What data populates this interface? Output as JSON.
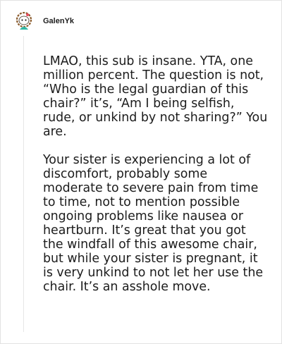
{
  "comment": {
    "username": "GalenYk",
    "avatar_icon": "snoo-avatar-icon",
    "paragraphs": [
      "LMAO, this sub is insane. YTA, one million percent. The question is not, “Who is the legal guardian of this chair?” it’s, “Am I being selfish, rude, or unkind by not sharing?” You are.",
      "Your sister is experiencing a lot of discomfort, probably some moderate to severe pain from time to time, not to mention possible ongoing problems like nausea or heartburn. It’s great that you got the windfall of this awesome chair, but while your sister is pregnant, it is very unkind to not let her use the chair. It’s an asshole move."
    ]
  },
  "colors": {
    "text": "#1c1c1c",
    "border": "#e3e3e3",
    "thread_line": "#e6e6e6",
    "avatar_hair": "#8a5a2b",
    "avatar_accent": "#2fb8a6"
  }
}
